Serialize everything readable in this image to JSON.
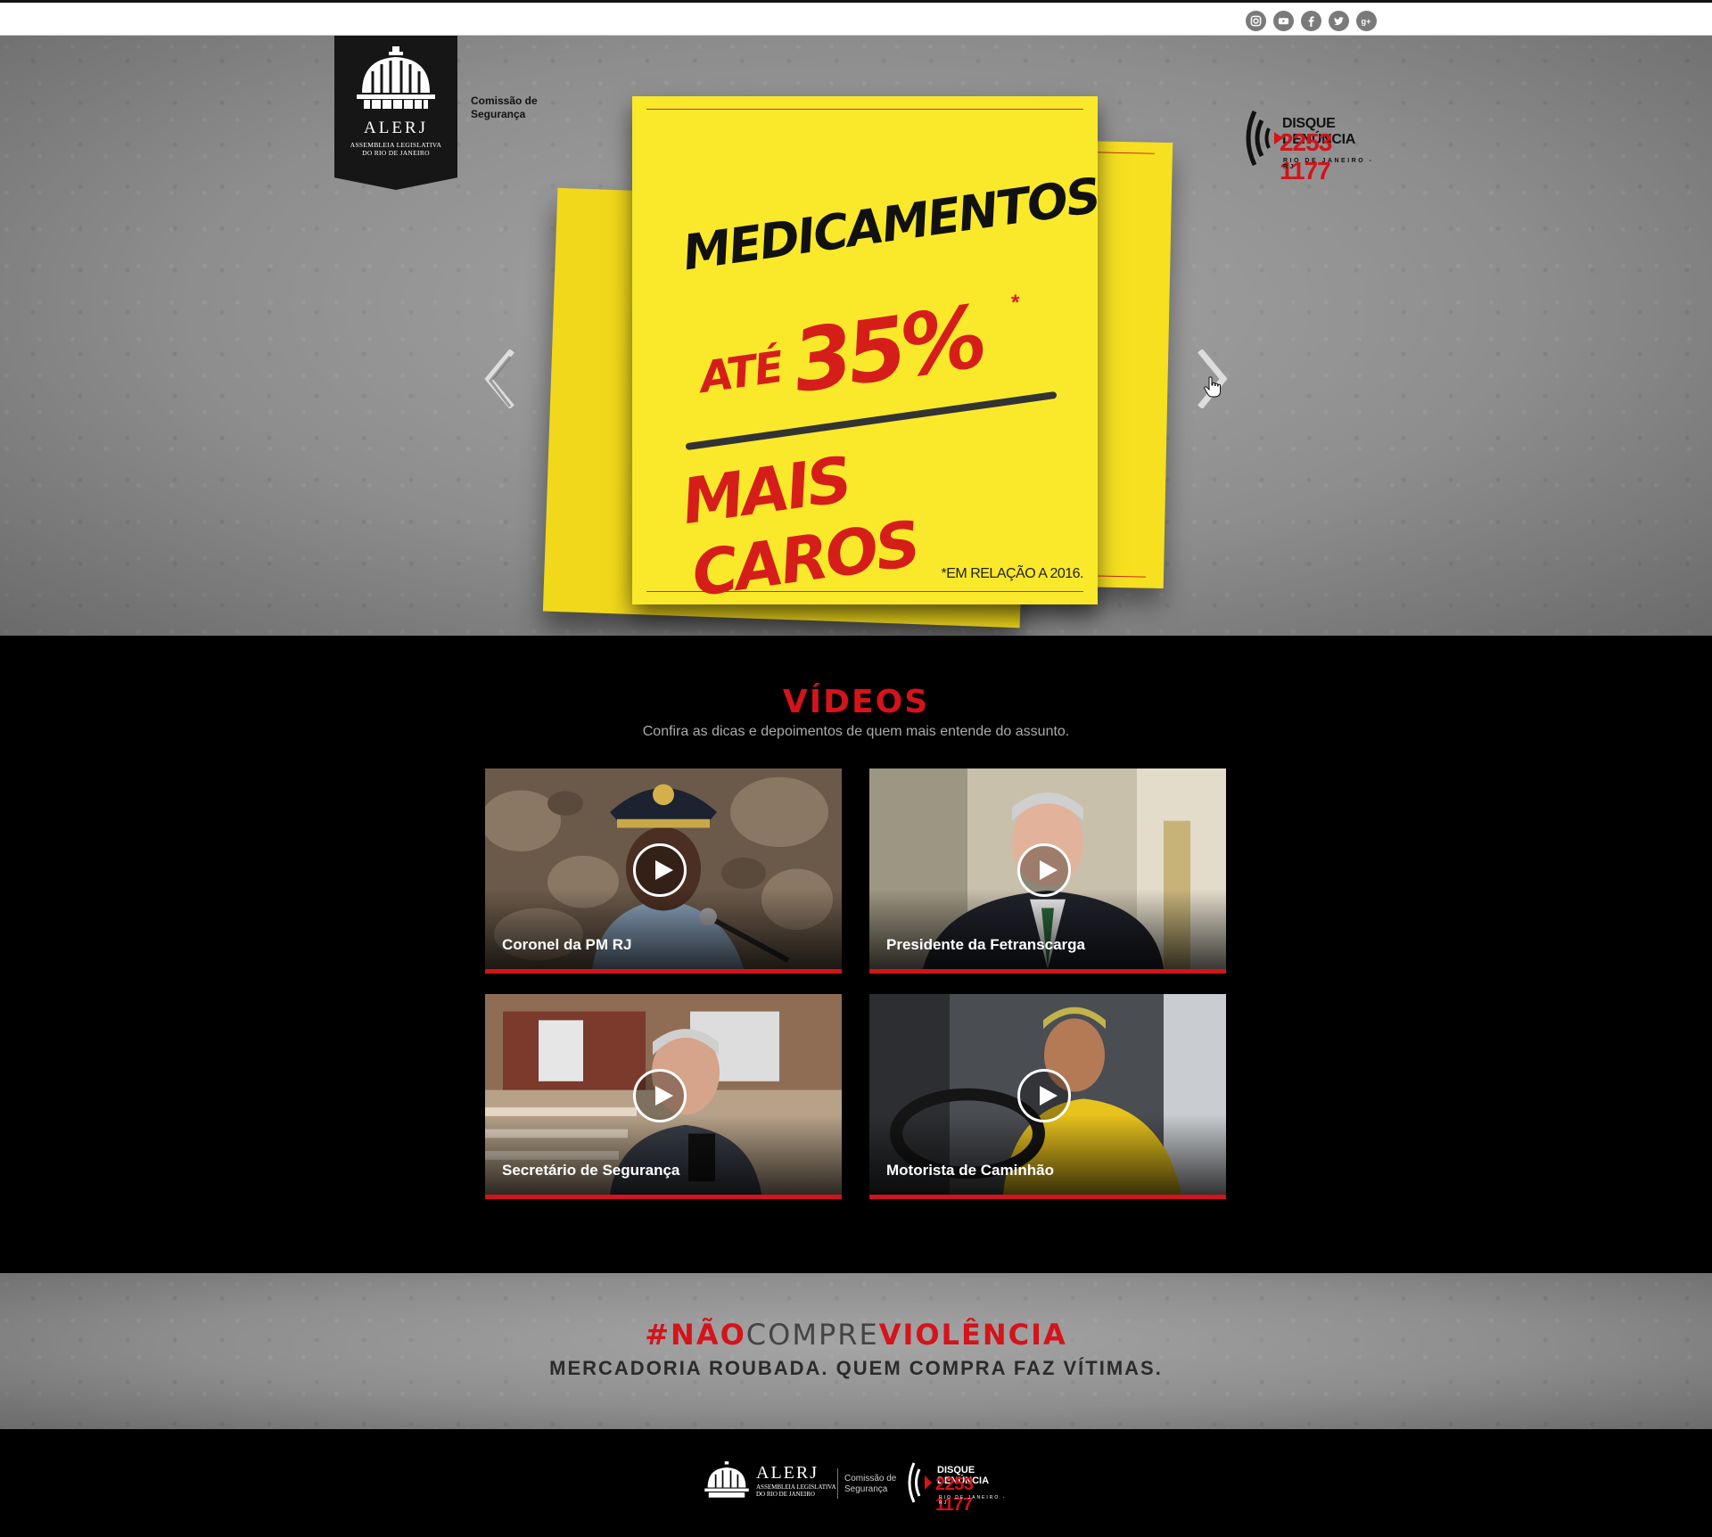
{
  "social": [
    {
      "name": "instagram-icon"
    },
    {
      "name": "youtube-icon"
    },
    {
      "name": "facebook-icon"
    },
    {
      "name": "twitter-icon"
    },
    {
      "name": "google-plus-icon"
    }
  ],
  "header": {
    "alerj_name": "ALERJ",
    "alerj_sub_line1": "ASSEMBLEIA LEGISLATIVA",
    "alerj_sub_line2": "DO RIO DE JANEIRO",
    "comissao_line1": "Comissão de",
    "comissao_line2": "Segurança",
    "disque_title": "DISQUE DENÚNCIA",
    "disque_phone": "2253 1177",
    "disque_city": "RIO DE JANEIRO - RJ"
  },
  "hero": {
    "line1": "MEDICAMENTOS",
    "line2_small": "ATÉ",
    "line2_big": "35%",
    "asterisk": "*",
    "line3": "MAIS CAROS",
    "footnote": "*EM RELAÇÃO A 2016."
  },
  "videos": {
    "title": "VÍDEOS",
    "subtitle": "Confira as dicas e depoimentos de quem mais entende do assunto.",
    "items": [
      {
        "caption": "Coronel da PM RJ"
      },
      {
        "caption": "Presidente da Fetranscarga"
      },
      {
        "caption": "Secretário de Segurança"
      },
      {
        "caption": "Motorista de Caminhão"
      }
    ]
  },
  "tagline": {
    "hash_start": "#NÃO",
    "hash_mid": "COMPRE",
    "hash_end": "VIOLÊNCIA",
    "slogan": "MERCADORIA ROUBADA. QUEM COMPRA FAZ VÍTIMAS."
  },
  "footer": {
    "alerj_name": "ALERJ",
    "alerj_sub_line1": "ASSEMBLEIA LEGISLATIVA",
    "alerj_sub_line2": "DO RIO DE JANEIRO",
    "comissao_line1": "Comissão de",
    "comissao_line2": "Segurança",
    "disque_title": "DISQUE DENÚNCIA",
    "disque_phone": "2253 1177",
    "disque_city": "RIO DE JANEIRO - RJ"
  },
  "colors": {
    "accent_red": "#d4131b",
    "note_yellow": "#fae92a"
  }
}
